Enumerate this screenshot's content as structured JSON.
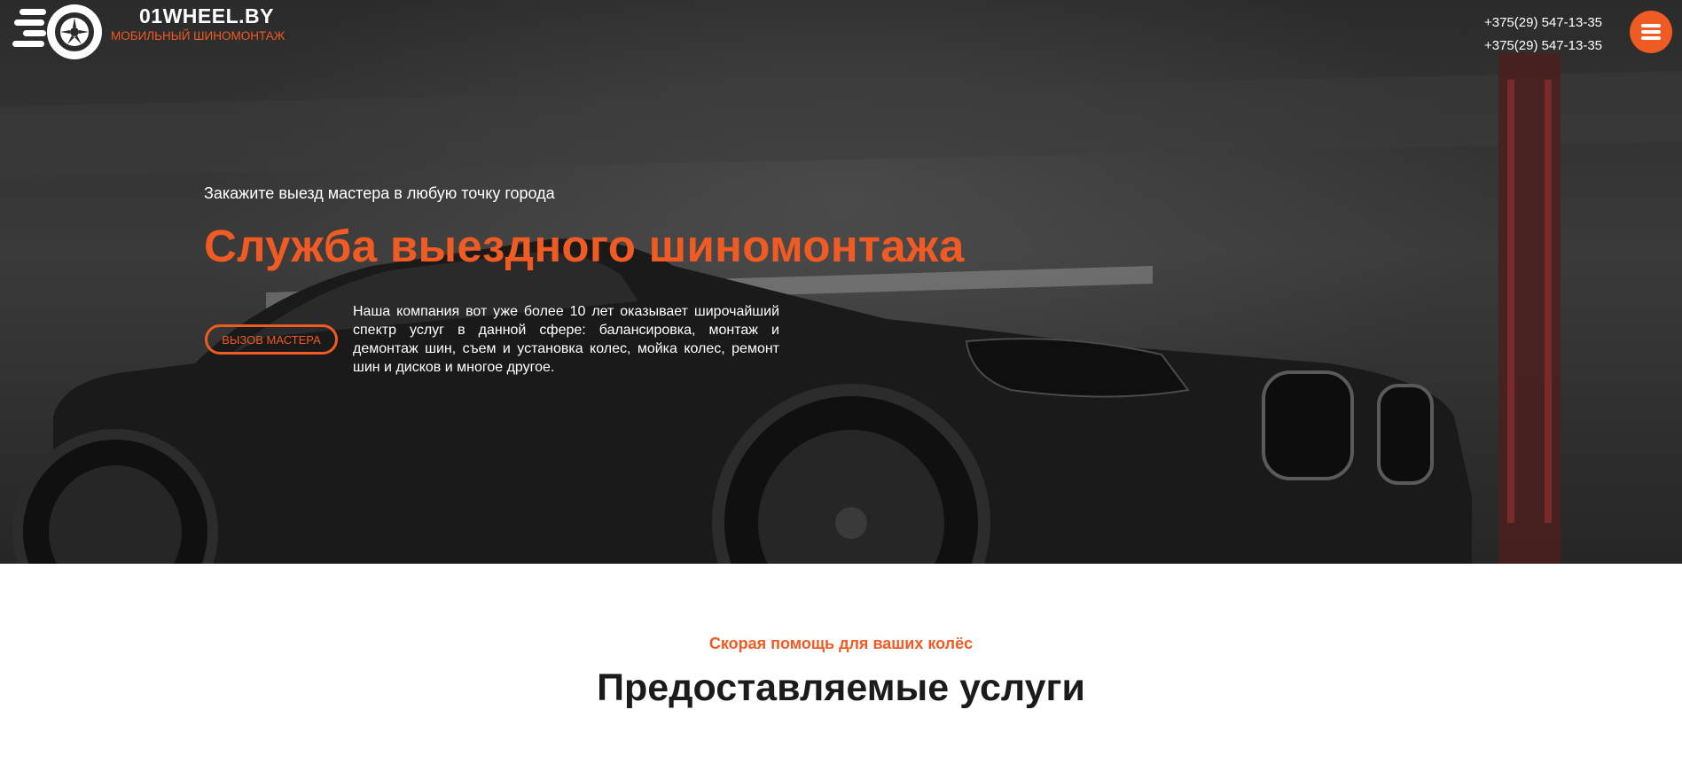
{
  "header": {
    "brand_name": "01WHEEL.BY",
    "brand_sub": "МОБИЛЬНЫЙ ШИНОМОНТАЖ",
    "phones": [
      "+375(29) 547-13-35",
      "+375(29) 547-13-35"
    ],
    "menu_icon": "hamburger-menu-icon"
  },
  "hero": {
    "pretitle": "Закажите выезд мастера в любую точку города",
    "title": "Служба выездного шиномонтажа",
    "cta_label": "ВЫЗОВ МАСТЕРА",
    "description": "Наша компания вот уже более 10 лет оказывает широчайший спектр услуг в данной сфере: балансировка, монтаж и демонтаж шин, съем и установка колес, мойка колес, ремонт шин и дисков и многое другое."
  },
  "services": {
    "pretitle": "Скорая помощь для ваших колёс",
    "title": "Предоставляемые услуги"
  },
  "colors": {
    "accent": "#f05a23",
    "hero_bg": "#2b2b2b",
    "heading_dark": "#1b1b1b",
    "white": "#ffffff"
  }
}
